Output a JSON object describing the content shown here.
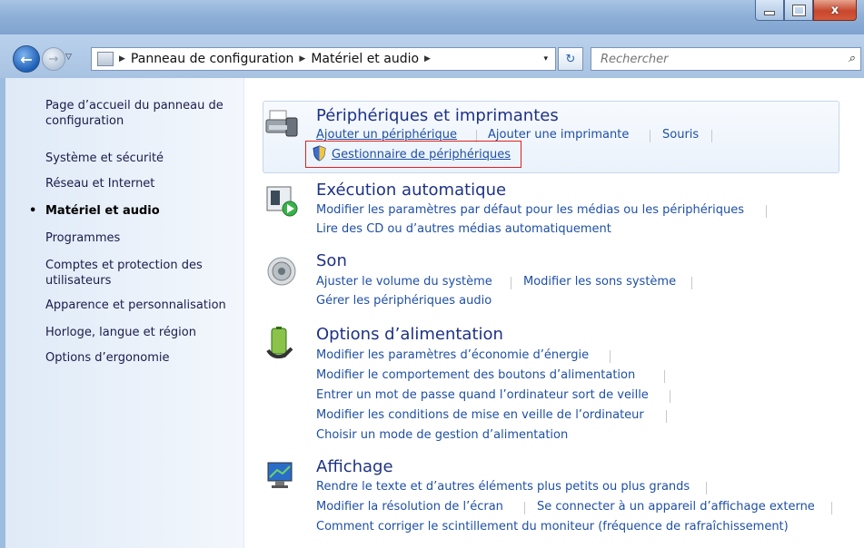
{
  "window": {
    "min_glyph": "–",
    "max_glyph": "□",
    "close_glyph": "x"
  },
  "nav": {
    "back_glyph": "←",
    "forward_glyph": "→",
    "history_glyph": "▽",
    "breadcrumb": [
      "Panneau de configuration",
      "Matériel et audio"
    ],
    "crumb_sep": "▶",
    "dropdown_glyph": "▾",
    "refresh_glyph": "↻",
    "search_placeholder": "Rechercher",
    "search_glyph": "⌕"
  },
  "sidebar": {
    "items": [
      {
        "label": "Page d’accueil du panneau de configuration",
        "active": false
      },
      {
        "label": "Système et sécurité",
        "active": false
      },
      {
        "label": "Réseau et Internet",
        "active": false
      },
      {
        "label": "Matériel et audio",
        "active": true
      },
      {
        "label": "Programmes",
        "active": false
      },
      {
        "label": "Comptes et protection des utilisateurs",
        "active": false
      },
      {
        "label": "Apparence et personnalisation",
        "active": false
      },
      {
        "label": "Horloge, langue et région",
        "active": false
      },
      {
        "label": "Options d’ergonomie",
        "active": false
      }
    ],
    "bullet": "•"
  },
  "categories": [
    {
      "title": "Périphériques et imprimantes",
      "icon": "printer-icon",
      "links": [
        "Ajouter un périphérique",
        "Ajouter une imprimante",
        "Souris",
        "Gestionnaire de périphériques"
      ]
    },
    {
      "title": "Exécution automatique",
      "icon": "autoplay-icon",
      "links": [
        "Modifier les paramètres par défaut pour les médias ou les périphériques",
        "Lire des CD ou d’autres médias automatiquement"
      ]
    },
    {
      "title": "Son",
      "icon": "speaker-icon",
      "links": [
        "Ajuster le volume du système",
        "Modifier les sons système",
        "Gérer les périphériques audio"
      ]
    },
    {
      "title": "Options d’alimentation",
      "icon": "battery-icon",
      "links": [
        "Modifier les paramètres d’économie d’énergie",
        "Modifier le comportement des boutons d’alimentation",
        "Entrer un mot de passe quand l’ordinateur sort de veille",
        "Modifier les conditions de mise en veille de l’ordinateur",
        "Choisir un mode de gestion d’alimentation"
      ]
    },
    {
      "title": "Affichage",
      "icon": "display-icon",
      "links": [
        "Rendre le texte et d’autres éléments plus petits ou plus grands",
        "Modifier la résolution de l’écran",
        "Se connecter à un appareil d’affichage externe",
        "Comment corriger le scintillement du moniteur (fréquence de rafraîchissement)"
      ]
    }
  ],
  "colors": {
    "link": "#1e4fa6",
    "title": "#1e3287",
    "highlight_border": "#e02020"
  }
}
